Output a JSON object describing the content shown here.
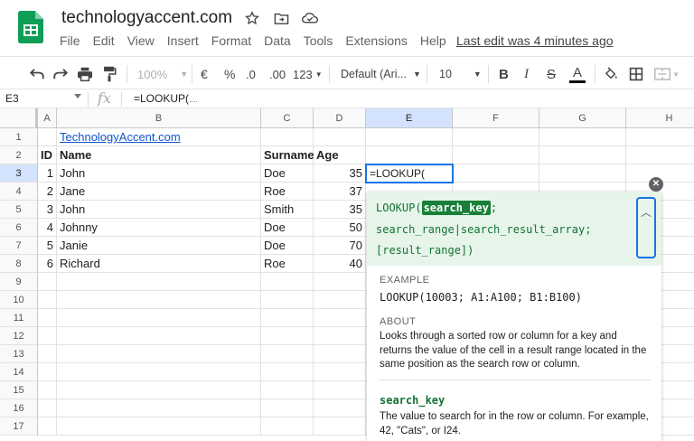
{
  "app": {
    "doc_title": "technologyaccent.com",
    "last_edit": "Last edit was 4 minutes ago",
    "brand_color": "#0f9d58"
  },
  "menu": [
    "File",
    "Edit",
    "View",
    "Insert",
    "Format",
    "Data",
    "Tools",
    "Extensions",
    "Help"
  ],
  "toolbar": {
    "zoom": "100%",
    "currency": "€",
    "percent": "%",
    "dec_decrease": ".0",
    "dec_increase": ".00",
    "more_formats": "123",
    "font": "Default (Ari...",
    "font_size": "10",
    "bold": "B",
    "italic": "I",
    "strike": "S",
    "text_color": "A"
  },
  "formula_bar": {
    "cell_ref": "E3",
    "fx": "fx",
    "content": "=LOOKUP("
  },
  "grid": {
    "columns": [
      "A",
      "B",
      "C",
      "D",
      "E",
      "F",
      "G",
      "H"
    ],
    "active_column": "E",
    "rows": [
      "1",
      "2",
      "3",
      "4",
      "5",
      "6",
      "7",
      "8",
      "9",
      "10",
      "11",
      "12",
      "13",
      "14",
      "15",
      "16",
      "17"
    ],
    "active_row": "3",
    "link_text": "TechnologyAccent.com",
    "headers": {
      "id": "ID",
      "name": "Name",
      "surname": "Surname",
      "age": "Age"
    },
    "records": [
      {
        "id": "1",
        "name": "John",
        "surname": "Doe",
        "age": "35"
      },
      {
        "id": "2",
        "name": "Jane",
        "surname": "Roe",
        "age": "37"
      },
      {
        "id": "3",
        "name": "John",
        "surname": "Smith",
        "age": "35"
      },
      {
        "id": "4",
        "name": "Johnny",
        "surname": "Doe",
        "age": "50"
      },
      {
        "id": "5",
        "name": "Janie",
        "surname": "Doe",
        "age": "70"
      },
      {
        "id": "6",
        "name": "Richard",
        "surname": "Roe",
        "age": "40"
      }
    ],
    "editing_cell_text": "=LOOKUP("
  },
  "help": {
    "fn": "LOOKUP(",
    "active_arg": "search_key",
    "sep1": ";",
    "line2": "search_range|search_result_array;",
    "line3": "[result_range])",
    "example_label": "EXAMPLE",
    "example": "LOOKUP(10003; A1:A100; B1:B100)",
    "about_label": "ABOUT",
    "about": "Looks through a sorted row or column for a key and returns the value of the cell in a result range located in the same position as the search row or column.",
    "param_name": "search_key",
    "param_desc": "The value to search for in the row or column. For example, 42, \"Cats\", or I24.",
    "accent_color": "#188038",
    "header_bg": "#e6f4ea"
  }
}
